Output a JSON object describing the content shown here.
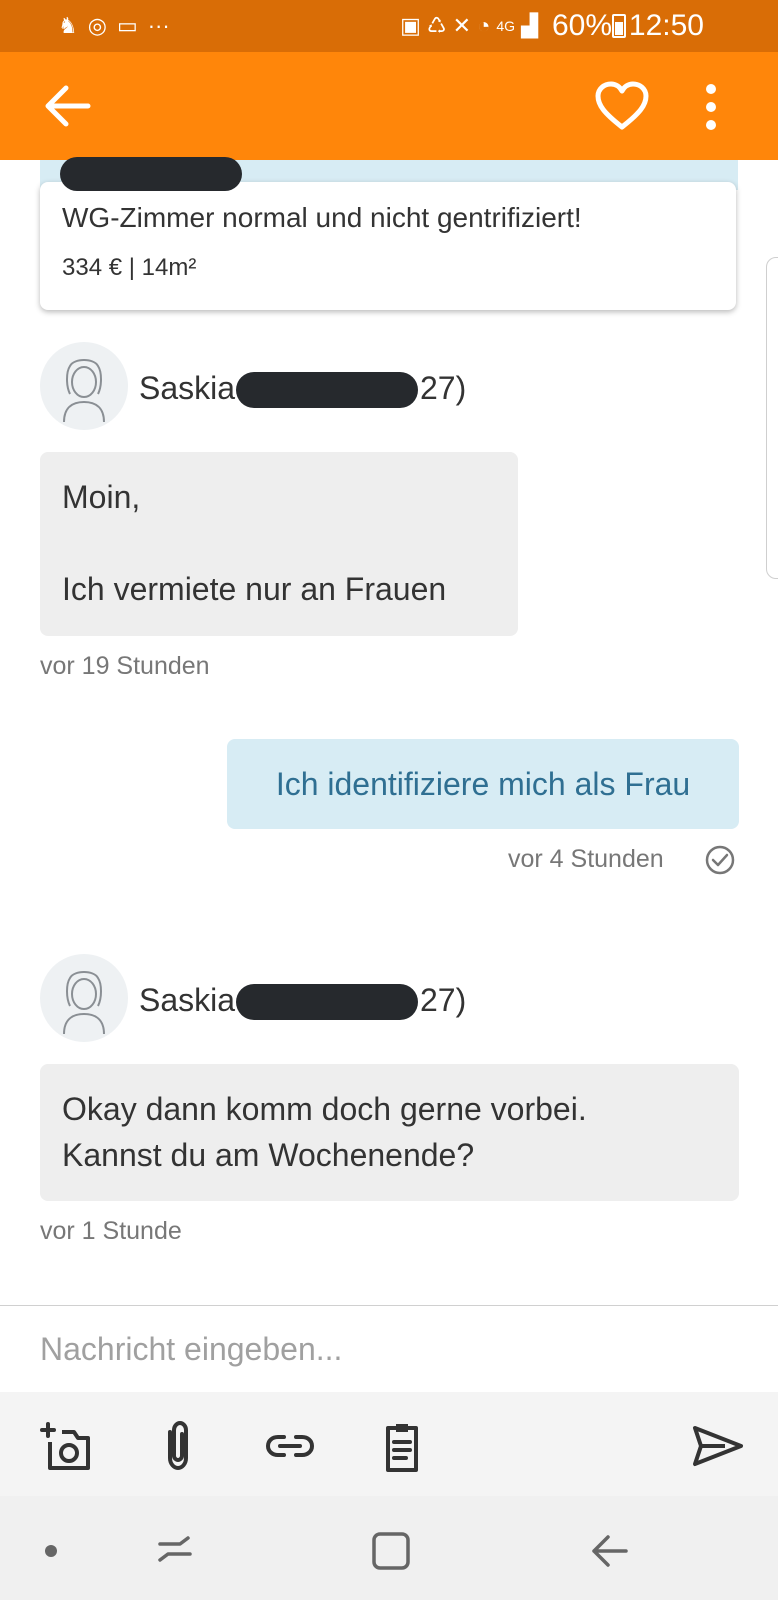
{
  "status_bar": {
    "battery": "60%",
    "time": "12:50",
    "network": "4G"
  },
  "app_bar": {
    "icons": [
      "back-arrow-icon",
      "heart-icon",
      "more-vert-icon"
    ]
  },
  "listing": {
    "title": "WG-Zimmer normal und nicht gentrifiziert!",
    "meta": "334 € | 14m²"
  },
  "messages": [
    {
      "direction": "in",
      "sender": "Saskia",
      "sender_suffix": "27)",
      "lines": [
        "Moin,",
        "",
        "Ich vermiete nur an Frauen"
      ],
      "time": "vor 19 Stunden"
    },
    {
      "direction": "out",
      "text": "Ich identifiziere mich als Frau",
      "time": "vor 4 Stunden",
      "status_icon": "read-check-icon"
    },
    {
      "direction": "in",
      "sender": "Saskia",
      "sender_suffix": "27)",
      "lines": [
        "Okay dann komm doch gerne vorbei.",
        "Kannst du am Wochenende?"
      ],
      "time": "vor 1 Stunde"
    }
  ],
  "composer": {
    "placeholder": "Nachricht eingeben..."
  },
  "toolbar": {
    "icons": [
      "add-photo-icon",
      "attachment-icon",
      "link-icon",
      "clipboard-icon",
      "send-icon"
    ]
  },
  "colors": {
    "status_bar": "#d96d06",
    "app_bar": "#ff860a",
    "outgoing_bubble": "#d7ecf4",
    "incoming_bubble": "#eeeeee",
    "outgoing_text": "#2f6f92"
  }
}
